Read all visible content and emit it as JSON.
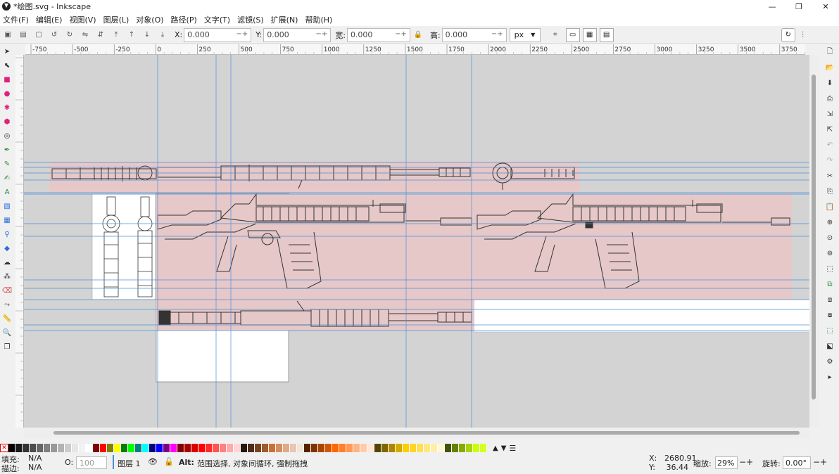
{
  "window": {
    "title": "*绘图.svg - Inkscape",
    "minimize": "—",
    "maximize": "❐",
    "close": "✕"
  },
  "menu": [
    "文件(F)",
    "编辑(E)",
    "视图(V)",
    "图层(L)",
    "对象(O)",
    "路径(P)",
    "文字(T)",
    "滤镜(S)",
    "扩展(N)",
    "帮助(H)"
  ],
  "controls": {
    "x_label": "X:",
    "x_value": "0.000",
    "y_label": "Y:",
    "y_value": "0.000",
    "w_label": "宽:",
    "w_value": "0.000",
    "h_label": "高:",
    "h_value": "0.000",
    "unit": "px",
    "spin_buttons": "−+"
  },
  "ruler": {
    "h_labels": [
      "-750",
      "-500",
      "-250",
      "0",
      "250",
      "500",
      "750",
      "1000",
      "1250",
      "1500",
      "1750",
      "2000",
      "2250",
      "2500",
      "2750",
      "3000",
      "3250",
      "3500",
      "3750"
    ]
  },
  "status": {
    "fill_label": "填充:",
    "fill_value": "N/A",
    "stroke_label": "描边:",
    "stroke_value": "N/A",
    "opacity_label": "O:",
    "opacity_value": "100",
    "layer": "图层 1",
    "hint_key": "Alt:",
    "hint": "范围选择, 对象间循环, 强制拖拽",
    "cursor_x_label": "X:",
    "cursor_x": "2680.91",
    "cursor_y_label": "Y:",
    "cursor_y": "36.44",
    "zoom_label": "缩放:",
    "zoom": "29%",
    "rotate_label": "旋转:",
    "rotate": "0.00°",
    "pm": "−+"
  },
  "colors": {
    "canvas_bg": "#d3d3d3",
    "selection_pink": "#e6c8c8",
    "guide_blue": "#4a90d9",
    "page_white": "#ffffff",
    "line_art": "#333333"
  },
  "palette": [
    "#000000",
    "#1a1a1a",
    "#333333",
    "#4d4d4d",
    "#666666",
    "#808080",
    "#999999",
    "#b3b3b3",
    "#cccccc",
    "#e6e6e6",
    "#f2f2f2",
    "#ffffff",
    "#800000",
    "#ff0000",
    "#808000",
    "#ffff00",
    "#008000",
    "#00ff00",
    "#008080",
    "#00ffff",
    "#000080",
    "#0000ff",
    "#800080",
    "#ff00ff",
    "#800000",
    "#aa0000",
    "#d40000",
    "#ff0000",
    "#ff2a2a",
    "#ff5555",
    "#ff8080",
    "#ffaaaa",
    "#ffd5d5",
    "#28170b",
    "#502d16",
    "#784421",
    "#a05a2c",
    "#c87137",
    "#d38d5f",
    "#deaa87",
    "#e9c6af",
    "#f4e3d7",
    "#552200",
    "#803300",
    "#aa4400",
    "#d45500",
    "#ff6600",
    "#ff7f2a",
    "#ff9955",
    "#ffb380",
    "#ffccaa",
    "#ffe6d5",
    "#554400",
    "#806600",
    "#aa8800",
    "#d4aa00",
    "#ffcc00",
    "#ffd42a",
    "#ffdd55",
    "#ffe680",
    "#ffeeaa",
    "#fff6d5",
    "#445500",
    "#668000",
    "#88aa00",
    "#aad400",
    "#ccff00",
    "#d4ff2a"
  ]
}
